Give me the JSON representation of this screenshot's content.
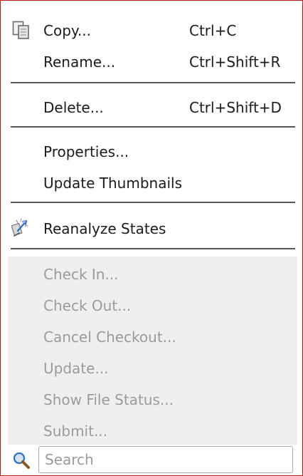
{
  "menu": {
    "items": [
      {
        "label": "Copy...",
        "shortcut": "Ctrl+C",
        "icon": "copy-icon"
      },
      {
        "label": "Rename...",
        "shortcut": "Ctrl+Shift+R"
      },
      {
        "label": "Delete...",
        "shortcut": "Ctrl+Shift+D"
      },
      {
        "label": "Properties..."
      },
      {
        "label": "Update Thumbnails"
      },
      {
        "label": "Reanalyze States",
        "icon": "reanalyze-icon"
      }
    ],
    "vcs_items": [
      {
        "label": "Check In..."
      },
      {
        "label": "Check Out..."
      },
      {
        "label": "Cancel Checkout..."
      },
      {
        "label": "Update..."
      },
      {
        "label": "Show File Status..."
      },
      {
        "label": "Submit..."
      }
    ],
    "search": {
      "placeholder": "Search",
      "icon": "search-icon"
    }
  },
  "colors": {
    "border": "#c01818",
    "text": "#1b1b1b",
    "disabled_text": "#9b9b9b",
    "disabled_background": "#efefef",
    "separator": "#555555"
  }
}
